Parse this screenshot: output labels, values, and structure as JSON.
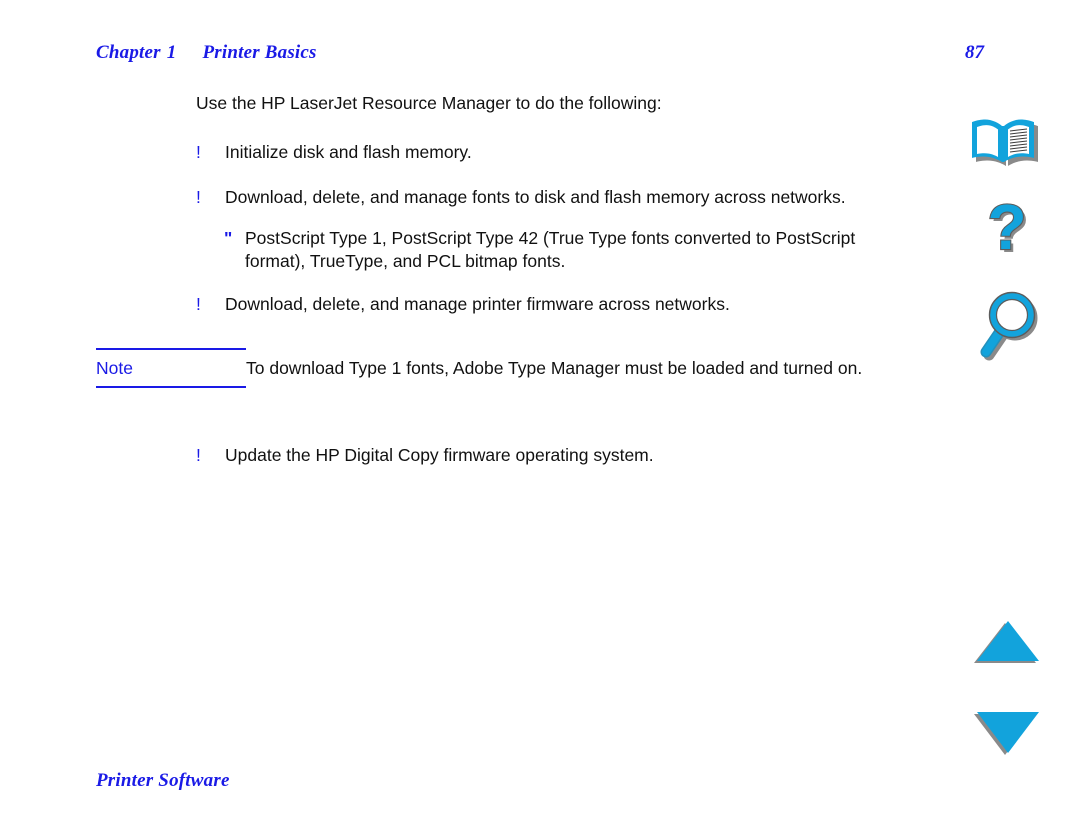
{
  "header": {
    "chapter_word": "Chapter",
    "chapter_number": "1",
    "chapter_title": "Printer Basics",
    "page_number": "87"
  },
  "body": {
    "intro": "Use the HP LaserJet Resource Manager to do the following:",
    "bullet_mark": "!",
    "subbullet_mark": "\"",
    "items": [
      "Initialize disk and flash memory.",
      "Download, delete, and manage fonts to disk and flash memory across networks.",
      "Download, delete, and manage printer firmware across networks."
    ],
    "subitems": [
      "PostScript Type 1, PostScript Type 42 (True Type fonts converted to PostScript format), TrueType, and PCL bitmap fonts."
    ],
    "post_note_item": "Update the HP Digital Copy firmware operating system."
  },
  "note": {
    "label": "Note",
    "text": "To download Type 1 fonts, Adobe Type Manager must be loaded and turned on."
  },
  "footer": {
    "section_title": "Printer Software"
  },
  "nav": {
    "icons": [
      {
        "name": "book-icon",
        "label": "Contents"
      },
      {
        "name": "question-mark-icon",
        "label": "Help"
      },
      {
        "name": "magnifier-icon",
        "label": "Search"
      },
      {
        "name": "triangle-up-icon",
        "label": "Previous page"
      },
      {
        "name": "triangle-down-icon",
        "label": "Next page"
      }
    ]
  },
  "colors": {
    "link_blue": "#1A1AE6",
    "icon_cyan": "#12A3DC",
    "icon_shadow": "#808080",
    "text_black": "#111111"
  }
}
